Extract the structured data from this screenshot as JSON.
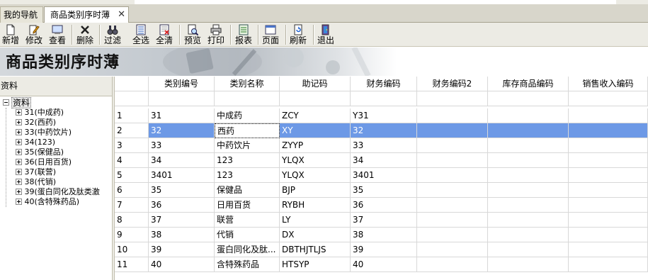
{
  "tabs": [
    {
      "label": "我的导航"
    },
    {
      "label": "商品类别序时薄",
      "close": "✕"
    }
  ],
  "toolbar": {
    "buttons": [
      {
        "label": "新增",
        "icon": "new-doc-icon"
      },
      {
        "label": "修改",
        "icon": "edit-doc-icon"
      },
      {
        "label": "查看",
        "icon": "view-icon"
      },
      {
        "label": "删除",
        "icon": "delete-x-icon"
      },
      {
        "label": "过滤",
        "icon": "filter-binoculars-icon"
      },
      {
        "label": "全选",
        "icon": "select-all-icon"
      },
      {
        "label": "全清",
        "icon": "clear-all-icon"
      },
      {
        "label": "预览",
        "icon": "preview-icon"
      },
      {
        "label": "打印",
        "icon": "printer-icon"
      },
      {
        "label": "报表",
        "icon": "report-icon"
      },
      {
        "label": "页面",
        "icon": "page-icon"
      },
      {
        "label": "刷新",
        "icon": "refresh-icon"
      },
      {
        "label": "退出",
        "icon": "exit-icon"
      }
    ]
  },
  "banner": {
    "title": "商品类别序时薄"
  },
  "left_panel": {
    "header": "资料",
    "tree_root": "资料",
    "tree_items": [
      "31(中成药)",
      "32(西药)",
      "33(中药饮片)",
      "34(123)",
      "35(保健品)",
      "36(日用百货)",
      "37(联营)",
      "38(代销)",
      "39(蛋白同化及肽类激",
      "40(含特殊药品)"
    ]
  },
  "grid": {
    "columns": [
      "类别编号",
      "类别名称",
      "助记码",
      "财务编码",
      "财务编码2",
      "库存商品编码",
      "销售收入编码"
    ],
    "selected_row_index": 1,
    "rows": [
      {
        "num": "1",
        "code": "31",
        "name": "中成药",
        "mnemonic": "ZCY",
        "fin": "Y31"
      },
      {
        "num": "2",
        "code": "32",
        "name": "西药",
        "mnemonic": "XY",
        "fin": "32"
      },
      {
        "num": "3",
        "code": "33",
        "name": "中药饮片",
        "mnemonic": "ZYYP",
        "fin": "33"
      },
      {
        "num": "4",
        "code": "34",
        "name": "123",
        "mnemonic": "YLQX",
        "fin": "34"
      },
      {
        "num": "5",
        "code": "3401",
        "name": "123",
        "mnemonic": "YLQX",
        "fin": "3401"
      },
      {
        "num": "6",
        "code": "35",
        "name": "保健品",
        "mnemonic": "BJP",
        "fin": "35"
      },
      {
        "num": "7",
        "code": "36",
        "name": "日用百货",
        "mnemonic": "RYBH",
        "fin": "36"
      },
      {
        "num": "8",
        "code": "37",
        "name": "联营",
        "mnemonic": "LY",
        "fin": "37"
      },
      {
        "num": "9",
        "code": "38",
        "name": "代销",
        "mnemonic": "DX",
        "fin": "38"
      },
      {
        "num": "10",
        "code": "39",
        "name": "蛋白同化及肽...",
        "mnemonic": "DBTHJTLJS",
        "fin": "39"
      },
      {
        "num": "11",
        "code": "40",
        "name": "含特殊药品",
        "mnemonic": "HTSYP",
        "fin": "40"
      }
    ]
  },
  "colors": {
    "selection": "#6d99e6",
    "toolbar_bg": "#ecebe4",
    "tab_bar_bg": "#d8d6cb"
  }
}
